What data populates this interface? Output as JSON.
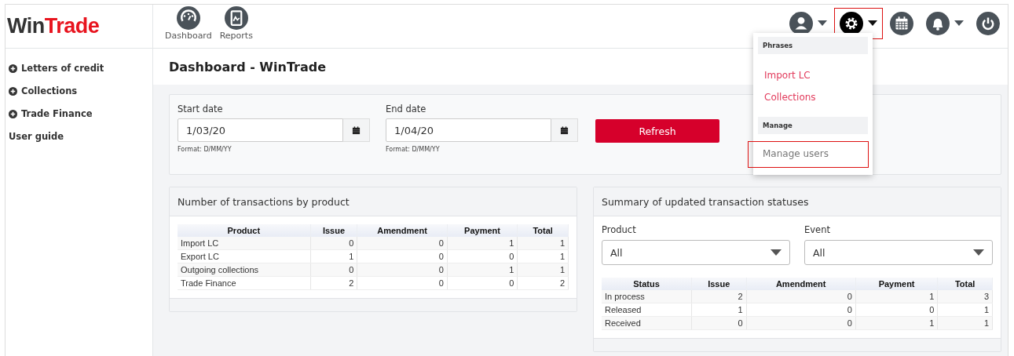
{
  "logo": [
    {
      "text": "Win",
      "kind": "base"
    },
    {
      "text": "Trade",
      "kind": "accent"
    }
  ],
  "nav": [
    {
      "label": "Dashboard"
    },
    {
      "label": "Reports"
    }
  ],
  "toolbar": [
    {
      "caret": true,
      "highlighted": false,
      "active": false
    },
    {
      "caret": true,
      "highlighted": true,
      "active": true
    },
    {
      "caret": false,
      "highlighted": false,
      "active": false
    },
    {
      "caret": true,
      "highlighted": false,
      "active": false
    },
    {
      "caret": false,
      "highlighted": false,
      "active": false
    }
  ],
  "settings_menu": {
    "sections": [
      {
        "heading": "Phrases",
        "items": [
          {
            "label": "Import LC",
            "kind": "link",
            "highlighted": false
          },
          {
            "label": "Collections",
            "kind": "link",
            "highlighted": false
          }
        ]
      },
      {
        "heading": "Manage",
        "items": [
          {
            "label": "Manage users",
            "kind": "plain",
            "highlighted": true
          }
        ]
      }
    ]
  },
  "sidebar": {
    "items": [
      {
        "label": "Letters of credit",
        "expandable": true
      },
      {
        "label": "Collections",
        "expandable": true
      },
      {
        "label": "Trade Finance",
        "expandable": true
      },
      {
        "label": "User guide",
        "expandable": false
      }
    ]
  },
  "page_title": "Dashboard - WinTrade",
  "filters": {
    "start_date": {
      "label": "Start date",
      "value": "1/03/20",
      "hint": "Format: D/MM/YY"
    },
    "end_date": {
      "label": "End date",
      "value": "1/04/20",
      "hint": "Format: D/MM/YY"
    },
    "button": "Refresh"
  },
  "product_panel": {
    "title": "Number of transactions by product",
    "columns": [
      "Product",
      "Issue",
      "Amendment",
      "Payment",
      "Total"
    ],
    "rows": [
      [
        "Import LC",
        "0",
        "0",
        "1",
        "1"
      ],
      [
        "Export LC",
        "1",
        "0",
        "0",
        "1"
      ],
      [
        "Outgoing collections",
        "0",
        "0",
        "1",
        "1"
      ],
      [
        "Trade Finance",
        "2",
        "0",
        "0",
        "2"
      ]
    ]
  },
  "status_panel": {
    "title": "Summary of updated transaction statuses",
    "selects": [
      {
        "label": "Product",
        "value": "All"
      },
      {
        "label": "Event",
        "value": "All"
      }
    ],
    "columns": [
      "Status",
      "Issue",
      "Amendment",
      "Payment",
      "Total"
    ],
    "rows": [
      [
        "In process",
        "2",
        "0",
        "1",
        "3"
      ],
      [
        "Released",
        "1",
        "0",
        "0",
        "1"
      ],
      [
        "Received",
        "0",
        "0",
        "1",
        "1"
      ]
    ]
  }
}
